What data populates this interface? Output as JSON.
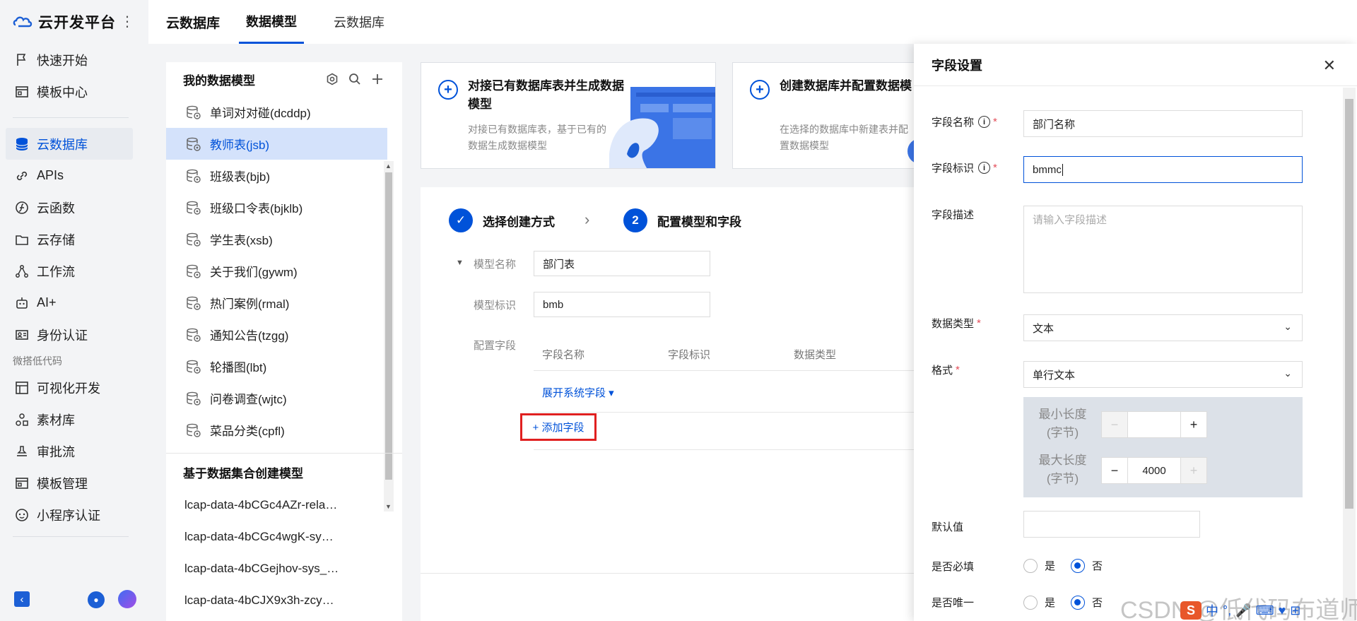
{
  "nav": {
    "brand": "云开发平台",
    "items_top": [
      {
        "label": "快速开始",
        "icon": "flag-icon"
      },
      {
        "label": "模板中心",
        "icon": "template-icon"
      }
    ],
    "items_main": [
      {
        "label": "云数据库",
        "icon": "database-icon",
        "active": true
      },
      {
        "label": "APIs",
        "icon": "link-icon"
      },
      {
        "label": "云函数",
        "icon": "function-icon"
      },
      {
        "label": "云存储",
        "icon": "folder-icon"
      },
      {
        "label": "工作流",
        "icon": "workflow-icon"
      },
      {
        "label": "AI+",
        "icon": "robot-icon"
      },
      {
        "label": "身份认证",
        "icon": "id-card-icon"
      }
    ],
    "group_lowcode": "微搭低代码",
    "items_lowcode": [
      {
        "label": "可视化开发",
        "icon": "layout-icon"
      },
      {
        "label": "素材库",
        "icon": "shapes-icon"
      },
      {
        "label": "审批流",
        "icon": "stamp-icon"
      },
      {
        "label": "模板管理",
        "icon": "template-icon"
      },
      {
        "label": "小程序认证",
        "icon": "miniprogram-icon"
      }
    ]
  },
  "topbar": {
    "title": "云数据库",
    "tabs": [
      "数据模型",
      "云数据库"
    ]
  },
  "models": {
    "title": "我的数据模型",
    "items": [
      "单词对对碰(dcddp)",
      "教师表(jsb)",
      "班级表(bjb)",
      "班级口令表(bjklb)",
      "学生表(xsb)",
      "关于我们(gywm)",
      "热门案例(rmal)",
      "通知公告(tzgg)",
      "轮播图(lbt)",
      "问卷调查(wjtc)",
      "菜品分类(cpfl)"
    ],
    "selected_index": 1,
    "sub_title": "基于数据集合创建模型",
    "sub_items": [
      "lcap-data-4bCGc4AZr-rela…",
      "lcap-data-4bCGc4wgK-sy…",
      "lcap-data-4bCGejhov-sys_…",
      "lcap-data-4bCJX9x3h-zcy…"
    ]
  },
  "cards": [
    {
      "title": "对接已有数据库表并生成数据模型",
      "desc": "对接已有数据库表，基于已有的数据生成数据模型"
    },
    {
      "title": "创建数据库并配置数据模",
      "desc": "在选择的数据库中新建表并配置数据模型"
    }
  ],
  "wizard": {
    "step1": "选择创建方式",
    "step2_num": "2",
    "step2": "配置模型和字段",
    "model_name_label": "模型名称",
    "model_name": "部门表",
    "model_id_label": "模型标识",
    "model_id": "bmb",
    "fields_label": "配置字段",
    "col_name": "字段名称",
    "col_id": "字段标识",
    "col_type": "数据类型",
    "expand": "展开系统字段 ▾",
    "add_field": "+ 添加字段"
  },
  "drawer": {
    "title": "字段设置",
    "field_name_label": "字段名称",
    "field_name": "部门名称",
    "field_id_label": "字段标识",
    "field_id": "bmmc",
    "desc_label": "字段描述",
    "desc_placeholder": "请输入字段描述",
    "type_label": "数据类型",
    "type_value": "文本",
    "format_label": "格式",
    "format_value": "单行文本",
    "min_len_label": "最小长度\n(字节)",
    "min_len_value": "",
    "max_len_label": "最大长度\n(字节)",
    "max_len_value": "4000",
    "default_label": "默认值",
    "required_label": "是否必填",
    "unique_label": "是否唯一",
    "yes": "是",
    "no": "否"
  },
  "watermark": "CSDN @低代码布道师",
  "ime": {
    "lang": "中"
  }
}
